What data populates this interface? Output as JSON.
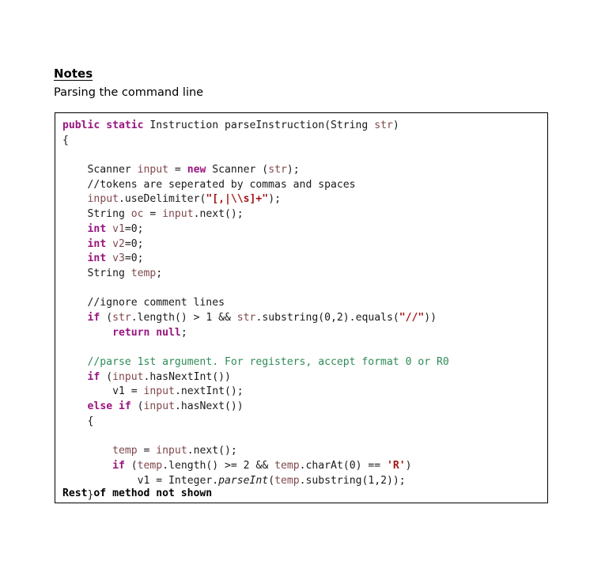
{
  "document": {
    "heading": "Notes",
    "subtitle": "Parsing the command line"
  },
  "colors": {
    "keyword": "#99157F",
    "variable": "#81484C",
    "string": "#A31515",
    "comment_green": "#2E8B57",
    "comment_plain": "#1a1a1a",
    "text": "#1a1a1a",
    "border": "#000000",
    "background": "#ffffff"
  },
  "code_block": {
    "language": "java",
    "footer_note": "Rest of method not shown",
    "lines": [
      [
        {
          "t": "public",
          "c": "kw"
        },
        {
          "t": " ",
          "c": "plain"
        },
        {
          "t": "static",
          "c": "kw"
        },
        {
          "t": " Instruction parseInstruction(String ",
          "c": "plain"
        },
        {
          "t": "str",
          "c": "var"
        },
        {
          "t": ")",
          "c": "plain"
        }
      ],
      [
        {
          "t": "{",
          "c": "plain"
        }
      ],
      [
        {
          "t": "",
          "c": "plain"
        }
      ],
      [
        {
          "t": "    Scanner ",
          "c": "plain"
        },
        {
          "t": "input",
          "c": "var"
        },
        {
          "t": " = ",
          "c": "plain"
        },
        {
          "t": "new",
          "c": "kw"
        },
        {
          "t": " Scanner (",
          "c": "plain"
        },
        {
          "t": "str",
          "c": "var"
        },
        {
          "t": ");",
          "c": "plain"
        }
      ],
      [
        {
          "t": "    //tokens are seperated by commas and spaces",
          "c": "cmt"
        }
      ],
      [
        {
          "t": "    ",
          "c": "plain"
        },
        {
          "t": "input",
          "c": "var"
        },
        {
          "t": ".useDelimiter(",
          "c": "plain"
        },
        {
          "t": "\"[,|\\\\s]+\"",
          "c": "str"
        },
        {
          "t": ");",
          "c": "plain"
        }
      ],
      [
        {
          "t": "    String ",
          "c": "plain"
        },
        {
          "t": "oc",
          "c": "var"
        },
        {
          "t": " = ",
          "c": "plain"
        },
        {
          "t": "input",
          "c": "var"
        },
        {
          "t": ".next();",
          "c": "plain"
        }
      ],
      [
        {
          "t": "    ",
          "c": "plain"
        },
        {
          "t": "int",
          "c": "kw"
        },
        {
          "t": " ",
          "c": "plain"
        },
        {
          "t": "v1",
          "c": "var"
        },
        {
          "t": "=0;",
          "c": "plain"
        }
      ],
      [
        {
          "t": "    ",
          "c": "plain"
        },
        {
          "t": "int",
          "c": "kw"
        },
        {
          "t": " ",
          "c": "plain"
        },
        {
          "t": "v2",
          "c": "var"
        },
        {
          "t": "=0;",
          "c": "plain"
        }
      ],
      [
        {
          "t": "    ",
          "c": "plain"
        },
        {
          "t": "int",
          "c": "kw"
        },
        {
          "t": " ",
          "c": "plain"
        },
        {
          "t": "v3",
          "c": "var"
        },
        {
          "t": "=0;",
          "c": "plain"
        }
      ],
      [
        {
          "t": "    String ",
          "c": "plain"
        },
        {
          "t": "temp",
          "c": "var"
        },
        {
          "t": ";",
          "c": "plain"
        }
      ],
      [
        {
          "t": "",
          "c": "plain"
        }
      ],
      [
        {
          "t": "    //ignore comment lines",
          "c": "cmt"
        }
      ],
      [
        {
          "t": "    ",
          "c": "plain"
        },
        {
          "t": "if",
          "c": "kw"
        },
        {
          "t": " (",
          "c": "plain"
        },
        {
          "t": "str",
          "c": "var"
        },
        {
          "t": ".length() > 1 && ",
          "c": "plain"
        },
        {
          "t": "str",
          "c": "var"
        },
        {
          "t": ".substring(0,2).equals(",
          "c": "plain"
        },
        {
          "t": "\"//\"",
          "c": "str"
        },
        {
          "t": "))",
          "c": "plain"
        }
      ],
      [
        {
          "t": "        ",
          "c": "plain"
        },
        {
          "t": "return",
          "c": "kw"
        },
        {
          "t": " ",
          "c": "plain"
        },
        {
          "t": "null",
          "c": "kw"
        },
        {
          "t": ";",
          "c": "plain"
        }
      ],
      [
        {
          "t": "",
          "c": "plain"
        }
      ],
      [
        {
          "t": "    //parse 1st argument. For registers, accept format 0 or R0",
          "c": "cmt-g"
        }
      ],
      [
        {
          "t": "    ",
          "c": "plain"
        },
        {
          "t": "if",
          "c": "kw"
        },
        {
          "t": " (",
          "c": "plain"
        },
        {
          "t": "input",
          "c": "var"
        },
        {
          "t": ".hasNextInt())",
          "c": "plain"
        }
      ],
      [
        {
          "t": "        ",
          "c": "plain"
        },
        {
          "t": "v1",
          "c": "plain"
        },
        {
          "t": " = ",
          "c": "plain"
        },
        {
          "t": "input",
          "c": "var"
        },
        {
          "t": ".nextInt();",
          "c": "plain"
        }
      ],
      [
        {
          "t": "    ",
          "c": "plain"
        },
        {
          "t": "else",
          "c": "kw"
        },
        {
          "t": " ",
          "c": "plain"
        },
        {
          "t": "if",
          "c": "kw"
        },
        {
          "t": " (",
          "c": "plain"
        },
        {
          "t": "input",
          "c": "var"
        },
        {
          "t": ".hasNext())",
          "c": "plain"
        }
      ],
      [
        {
          "t": "    {",
          "c": "plain"
        }
      ],
      [
        {
          "t": "",
          "c": "plain"
        }
      ],
      [
        {
          "t": "        ",
          "c": "plain"
        },
        {
          "t": "temp",
          "c": "var"
        },
        {
          "t": " = ",
          "c": "plain"
        },
        {
          "t": "input",
          "c": "var"
        },
        {
          "t": ".next();",
          "c": "plain"
        }
      ],
      [
        {
          "t": "        ",
          "c": "plain"
        },
        {
          "t": "if",
          "c": "kw"
        },
        {
          "t": " (",
          "c": "plain"
        },
        {
          "t": "temp",
          "c": "var"
        },
        {
          "t": ".length() >= 2 && ",
          "c": "plain"
        },
        {
          "t": "temp",
          "c": "var"
        },
        {
          "t": ".charAt(0) == ",
          "c": "plain"
        },
        {
          "t": "'R'",
          "c": "str"
        },
        {
          "t": ")",
          "c": "plain"
        }
      ],
      [
        {
          "t": "            ",
          "c": "plain"
        },
        {
          "t": "v1",
          "c": "plain"
        },
        {
          "t": " = Integer.",
          "c": "plain"
        },
        {
          "t": "parseInt",
          "c": "ital"
        },
        {
          "t": "(",
          "c": "plain"
        },
        {
          "t": "temp",
          "c": "var"
        },
        {
          "t": ".substring(1,2));",
          "c": "plain"
        }
      ],
      [
        {
          "t": "    }",
          "c": "plain"
        }
      ]
    ]
  }
}
